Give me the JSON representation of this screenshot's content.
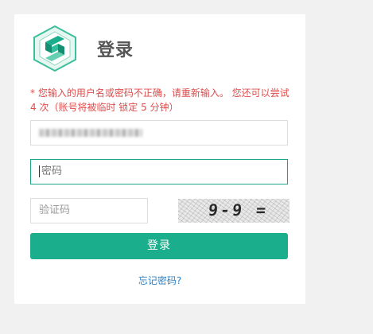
{
  "header": {
    "title": "登录",
    "logo_name": "app-logo"
  },
  "error": {
    "message": "* 您输入的用户名或密码不正确，请重新输入。 您还可以尝试 4 次（账号将被临时 锁定 5 分钟）"
  },
  "form": {
    "password_placeholder": "密码",
    "captcha_placeholder": "验证码",
    "captcha_text": "9-9 =",
    "submit_label": "登录",
    "forgot_label": "忘记密码?"
  },
  "colors": {
    "accent": "#1aae8c",
    "error": "#e04b4b",
    "link": "#2d7fc1"
  }
}
